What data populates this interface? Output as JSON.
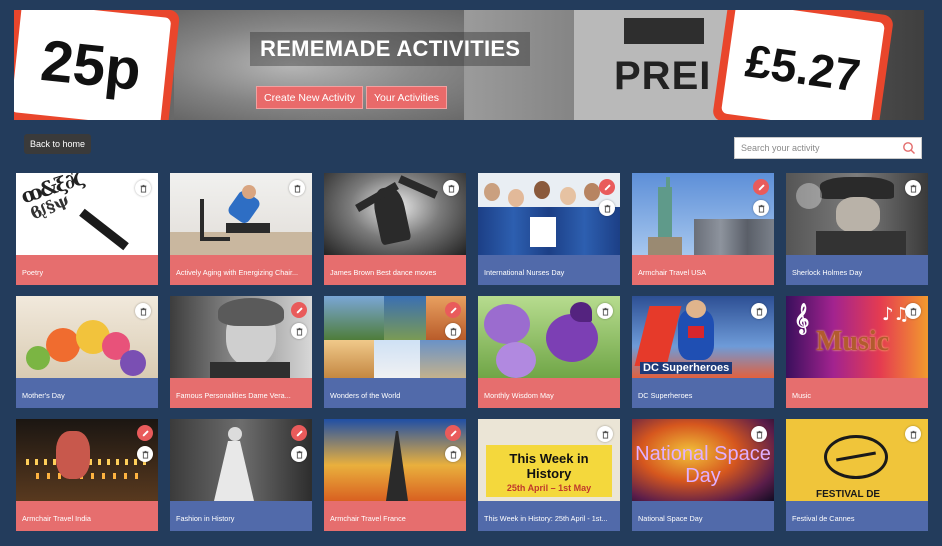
{
  "banner": {
    "title": "REMEMADE ACTIVITIES",
    "left_price": "25p",
    "right_price": "£5.27",
    "sign_text": "PREI",
    "create_label": "Create New Activity",
    "yours_label": "Your Activities"
  },
  "controls": {
    "back_label": "Back to home",
    "search_placeholder": "Search your activity"
  },
  "colors": {
    "page_bg": "#233c5c",
    "caption_pink": "#e66e6e",
    "caption_blue": "#516aaa",
    "edit_red": "#e95b5b"
  },
  "activities": [
    {
      "title": "Poetry",
      "caption": "pink",
      "editable": false,
      "image": "calligraphy-letters"
    },
    {
      "title": "Actively Aging with Energizing Chair...",
      "caption": "pink",
      "editable": false,
      "image": "chair-exercise"
    },
    {
      "title": "James Brown Best dance moves",
      "caption": "pink",
      "editable": false,
      "image": "dancer-bw"
    },
    {
      "title": "International Nurses Day",
      "caption": "blue",
      "editable": true,
      "image": "nurses-group"
    },
    {
      "title": "Armchair Travel USA",
      "caption": "pink",
      "editable": true,
      "image": "statue-of-liberty"
    },
    {
      "title": "Sherlock Holmes Day",
      "caption": "blue",
      "editable": false,
      "image": "detective-pipe"
    },
    {
      "title": "Mother's Day",
      "caption": "blue",
      "editable": false,
      "image": "flower-bouquet"
    },
    {
      "title": "Famous Personalities Dame Vera...",
      "caption": "pink",
      "editable": true,
      "image": "vintage-portrait"
    },
    {
      "title": "Wonders of the World",
      "caption": "blue",
      "editable": true,
      "image": "world-wonders-collage"
    },
    {
      "title": "Monthly Wisdom May",
      "caption": "pink",
      "editable": false,
      "image": "purple-flowers"
    },
    {
      "title": "DC Superheroes",
      "caption": "blue",
      "editable": false,
      "image": "superhero-comic",
      "overlay": "DC Superheroes"
    },
    {
      "title": "Music",
      "caption": "pink",
      "editable": false,
      "image": "music-notes",
      "overlay": "Music"
    },
    {
      "title": "Armchair Travel India",
      "caption": "pink",
      "editable": true,
      "image": "candle-festival"
    },
    {
      "title": "Fashion in History",
      "caption": "blue",
      "editable": true,
      "image": "vintage-dress"
    },
    {
      "title": "Armchair Travel France",
      "caption": "pink",
      "editable": true,
      "image": "eiffel-tower-sunset"
    },
    {
      "title": "This Week in History: 25th April - 1st...",
      "caption": "blue",
      "editable": false,
      "image": "history-note",
      "overlay": "This Week in History",
      "overlay_sub": "25th April – 1st May"
    },
    {
      "title": "National Space Day",
      "caption": "blue",
      "editable": false,
      "image": "nebula",
      "overlay": "National Space Day"
    },
    {
      "title": "Festival de Cannes",
      "caption": "blue",
      "editable": false,
      "image": "cannes-palm",
      "overlay": "FESTIVAL DE"
    }
  ]
}
